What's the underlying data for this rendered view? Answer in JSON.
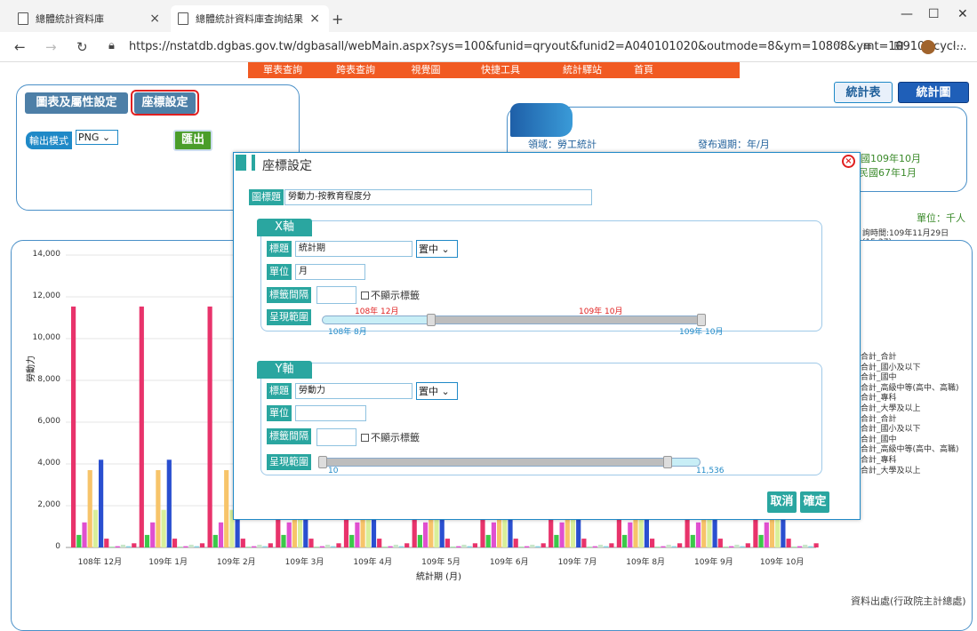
{
  "browser": {
    "tabs": [
      {
        "title": "總體統計資料庫",
        "active": false
      },
      {
        "title": "總體統計資料庫查詢結果",
        "active": true
      }
    ],
    "new_tab": "+",
    "url": "https://nstatdb.dgbas.gov.tw/dgbasall/webMain.aspx?sys=100&funid=qryout&funid2=A040101020&outmode=8&ym=10808&ymt=10910&cycl..."
  },
  "menu": [
    "單表查詢",
    "跨表查詢",
    "視覺圖",
    "快捷工具",
    "統計驛站",
    "首頁"
  ],
  "left_panel": {
    "tab_chart_settings": "圖表及屬性設定",
    "tab_axis_settings": "座標設定",
    "output_mode_label": "輸出模式",
    "output_mode_value": "PNG",
    "export_button": "匯出"
  },
  "right_panel": {
    "stat_table": "統計表",
    "stat_chart": "統計圖",
    "domain": "領域：勞工統計",
    "period": "發布週期：年/月",
    "range_end": "國109年10月",
    "range_start": "民國67年1月",
    "unit": "單位：千人",
    "query_time": "詢時間:109年11月29日(15:27)"
  },
  "chart_data": {
    "type": "bar",
    "ylabel": "勞動力",
    "xlabel": "統計期 (月)",
    "ylim": [
      0,
      14000
    ],
    "yticks": [
      "0",
      "2,000",
      "4,000",
      "6,000",
      "8,000",
      "10,000",
      "12,000",
      "14,000"
    ],
    "categories": [
      "108年 12月",
      "109年 1月",
      "109年 2月",
      "109年 3月",
      "109年 4月",
      "109年 5月",
      "109年 6月",
      "109年 7月",
      "109年 8月",
      "109年 9月",
      "109年 10月"
    ],
    "series": [
      {
        "name": "合計_合計",
        "color": "#e8336b",
        "values": [
          11536,
          11536,
          11536,
          11536,
          11536,
          11536,
          11536,
          11536,
          11536,
          11536,
          11536
        ]
      },
      {
        "name": "合計_國小及以下",
        "color": "#3cc84a",
        "values": [
          600,
          600,
          600,
          600,
          600,
          600,
          600,
          600,
          600,
          600,
          600
        ]
      },
      {
        "name": "合計_國中",
        "color": "#e04fd0",
        "values": [
          1200,
          1200,
          1200,
          1200,
          1200,
          1200,
          1200,
          1200,
          1200,
          1200,
          1200
        ]
      },
      {
        "name": "合計_高級中等(高中、高職)",
        "color": "#f7c46a",
        "values": [
          3700,
          3700,
          3700,
          3700,
          3700,
          3700,
          3700,
          3700,
          3700,
          3700,
          3700
        ]
      },
      {
        "name": "合計_專科",
        "color": "#d8ef9a",
        "values": [
          1800,
          1800,
          1800,
          1800,
          1800,
          1800,
          1800,
          1800,
          1800,
          1800,
          1800
        ]
      },
      {
        "name": "合計_大學及以上",
        "color": "#2a4fd0",
        "values": [
          4200,
          4200,
          4200,
          4200,
          4200,
          4200,
          4200,
          4200,
          4200,
          4200,
          4200
        ]
      },
      {
        "name": "合計_合計",
        "color": "#e8336b",
        "values": [
          420,
          420,
          420,
          420,
          420,
          420,
          420,
          420,
          420,
          420,
          420
        ]
      },
      {
        "name": "合計_國小及以下",
        "color": "#3cc84a",
        "values": [
          20,
          20,
          20,
          20,
          20,
          20,
          20,
          20,
          20,
          20,
          20
        ]
      },
      {
        "name": "合計_國中",
        "color": "#e04fd0",
        "values": [
          60,
          60,
          60,
          60,
          60,
          60,
          60,
          60,
          60,
          60,
          60
        ]
      },
      {
        "name": "合計_高級中等(高中、高職)",
        "color": "#c8e6c9",
        "values": [
          130,
          130,
          130,
          130,
          130,
          130,
          130,
          130,
          130,
          130,
          130
        ]
      },
      {
        "name": "合計_專科",
        "color": "#7fd0e0",
        "values": [
          60,
          60,
          60,
          60,
          60,
          60,
          60,
          60,
          60,
          60,
          60
        ]
      },
      {
        "name": "合計_大學及以上",
        "color": "#e8336b",
        "values": [
          200,
          200,
          200,
          200,
          200,
          200,
          200,
          200,
          200,
          200,
          200
        ]
      }
    ]
  },
  "footer": "資料出處(行政院主計總處)",
  "dialog": {
    "title": "座標設定",
    "chart_title_label": "圖標題",
    "chart_title_value": "勞動力-按教育程度分",
    "x_axis": {
      "header": "X軸",
      "title_label": "標題",
      "title_value": "統計期",
      "align": "置中",
      "unit_label": "單位",
      "unit_value": "月",
      "interval_label": "標籤間隔",
      "hide_labels": "不顯示標籤",
      "range_label": "呈現範圍",
      "sel_start": "108年 12月",
      "sel_end": "109年 10月",
      "min": "108年 8月",
      "max": "109年 10月"
    },
    "y_axis": {
      "header": "Y軸",
      "title_label": "標題",
      "title_value": "勞動力",
      "align": "置中",
      "unit_label": "單位",
      "unit_value": "",
      "interval_label": "標籤間隔",
      "hide_labels": "不顯示標籤",
      "range_label": "呈現範圍",
      "min": "10",
      "max": "11,536"
    },
    "cancel": "取消",
    "confirm": "確定"
  }
}
